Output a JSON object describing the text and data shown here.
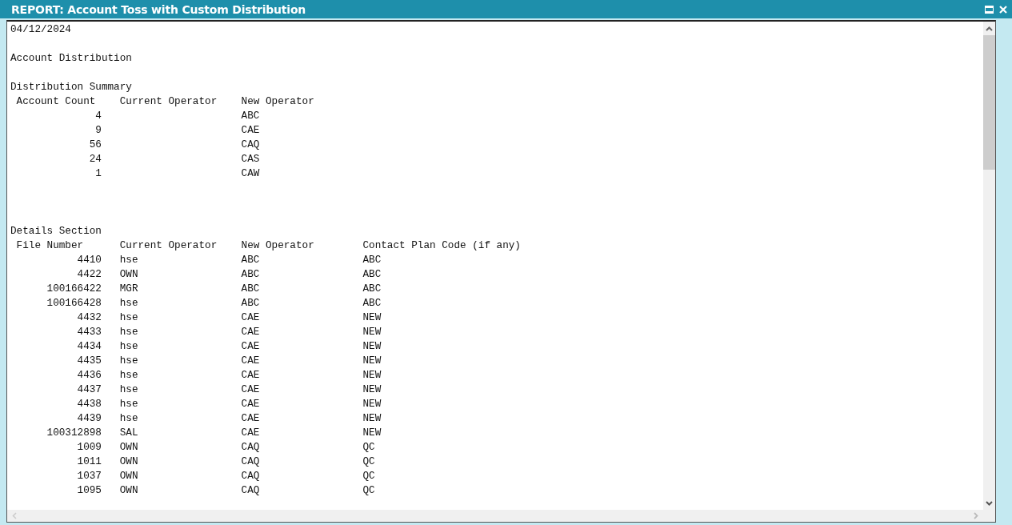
{
  "window": {
    "title": "REPORT: Account Toss with Custom Distribution"
  },
  "report": {
    "date": "04/12/2024",
    "heading": "Account Distribution",
    "summary": {
      "title": "Distribution Summary",
      "columns": [
        "Account Count",
        "Current Operator",
        "New Operator"
      ],
      "rows": [
        {
          "account_count": "4",
          "new_operator": "ABC"
        },
        {
          "account_count": "9",
          "new_operator": "CAE"
        },
        {
          "account_count": "56",
          "new_operator": "CAQ"
        },
        {
          "account_count": "24",
          "new_operator": "CAS"
        },
        {
          "account_count": "1",
          "new_operator": "CAW"
        }
      ]
    },
    "details": {
      "title": "Details Section",
      "columns": [
        "File Number",
        "Current Operator",
        "New Operator",
        "Contact Plan Code (if any)"
      ],
      "rows": [
        {
          "file_number": "4410",
          "current_operator": "hse",
          "new_operator": "ABC",
          "contact_plan_code": "ABC"
        },
        {
          "file_number": "4422",
          "current_operator": "OWN",
          "new_operator": "ABC",
          "contact_plan_code": "ABC"
        },
        {
          "file_number": "100166422",
          "current_operator": "MGR",
          "new_operator": "ABC",
          "contact_plan_code": "ABC"
        },
        {
          "file_number": "100166428",
          "current_operator": "hse",
          "new_operator": "ABC",
          "contact_plan_code": "ABC"
        },
        {
          "file_number": "4432",
          "current_operator": "hse",
          "new_operator": "CAE",
          "contact_plan_code": "NEW"
        },
        {
          "file_number": "4433",
          "current_operator": "hse",
          "new_operator": "CAE",
          "contact_plan_code": "NEW"
        },
        {
          "file_number": "4434",
          "current_operator": "hse",
          "new_operator": "CAE",
          "contact_plan_code": "NEW"
        },
        {
          "file_number": "4435",
          "current_operator": "hse",
          "new_operator": "CAE",
          "contact_plan_code": "NEW"
        },
        {
          "file_number": "4436",
          "current_operator": "hse",
          "new_operator": "CAE",
          "contact_plan_code": "NEW"
        },
        {
          "file_number": "4437",
          "current_operator": "hse",
          "new_operator": "CAE",
          "contact_plan_code": "NEW"
        },
        {
          "file_number": "4438",
          "current_operator": "hse",
          "new_operator": "CAE",
          "contact_plan_code": "NEW"
        },
        {
          "file_number": "4439",
          "current_operator": "hse",
          "new_operator": "CAE",
          "contact_plan_code": "NEW"
        },
        {
          "file_number": "100312898",
          "current_operator": "SAL",
          "new_operator": "CAE",
          "contact_plan_code": "NEW"
        },
        {
          "file_number": "1009",
          "current_operator": "OWN",
          "new_operator": "CAQ",
          "contact_plan_code": "QC"
        },
        {
          "file_number": "1011",
          "current_operator": "OWN",
          "new_operator": "CAQ",
          "contact_plan_code": "QC"
        },
        {
          "file_number": "1037",
          "current_operator": "OWN",
          "new_operator": "CAQ",
          "contact_plan_code": "QC"
        },
        {
          "file_number": "1095",
          "current_operator": "OWN",
          "new_operator": "CAQ",
          "contact_plan_code": "QC"
        }
      ]
    }
  }
}
